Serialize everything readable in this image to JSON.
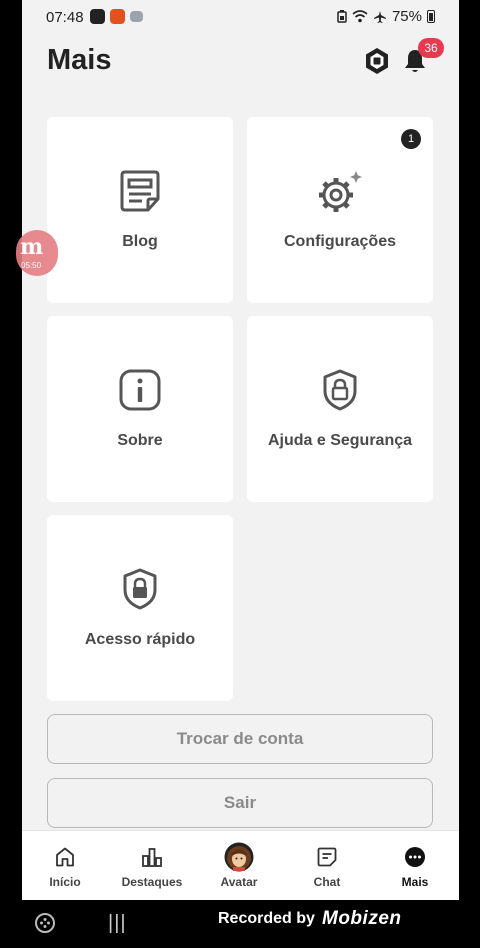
{
  "status_bar": {
    "time": "07:48",
    "battery": "75%",
    "icons": [
      "mobizen-icon",
      "notification-app-icon",
      "gallery-icon",
      "battery-saver-icon",
      "wifi-icon",
      "airplane-icon",
      "battery-icon"
    ]
  },
  "header": {
    "title": "Mais",
    "notification_count": "36",
    "icons": [
      "robux-icon",
      "bell-icon"
    ]
  },
  "tiles": [
    {
      "label": "Blog",
      "icon": "blog-icon"
    },
    {
      "label": "Configurações",
      "icon": "gear-icon",
      "badge": "1"
    },
    {
      "label": "Sobre",
      "icon": "info-icon"
    },
    {
      "label": "Ajuda e Segurança",
      "icon": "shield-lock-icon"
    },
    {
      "label": "Acesso rápido",
      "icon": "shield-lock-icon"
    }
  ],
  "buttons": {
    "switch_account": "Trocar de conta",
    "logout": "Sair"
  },
  "bottom_nav": {
    "items": [
      {
        "label": "Início",
        "icon": "home-icon"
      },
      {
        "label": "Destaques",
        "icon": "chart-icon"
      },
      {
        "label": "Avatar",
        "icon": "avatar-icon"
      },
      {
        "label": "Chat",
        "icon": "chat-icon"
      },
      {
        "label": "Mais",
        "icon": "more-icon",
        "active": true
      }
    ]
  },
  "recorder_bubble": {
    "letter": "m",
    "time": "05:50"
  },
  "system_nav": {
    "recents": "|||",
    "recorded_by": "Recorded by",
    "brand": "Mobizen"
  },
  "colors": {
    "background": "#f2f2f3",
    "tile": "#ffffff",
    "badge_red": "#e8394f",
    "text_dark": "#222222",
    "text_muted": "#8a8a8a"
  }
}
